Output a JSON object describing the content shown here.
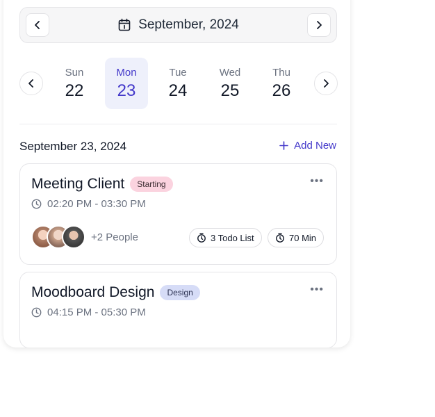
{
  "calendar": {
    "month_title": "September, 2024",
    "days": [
      {
        "name": "Sun",
        "num": "22"
      },
      {
        "name": "Mon",
        "num": "23"
      },
      {
        "name": "Tue",
        "num": "24"
      },
      {
        "name": "Wed",
        "num": "25"
      },
      {
        "name": "Thu",
        "num": "26"
      }
    ],
    "selected_index": 1
  },
  "schedule": {
    "date_heading": "September 23, 2024",
    "add_new_label": "Add New",
    "events": [
      {
        "title": "Meeting Client",
        "badge": "Starting",
        "time": "02:20 PM - 03:30 PM",
        "people_more": "+2 People",
        "todo": "3 Todo List",
        "duration": "70 Min"
      },
      {
        "title": "Moodboard Design",
        "badge": "Design",
        "time": "04:15 PM - 05:30 PM"
      }
    ]
  },
  "colors": {
    "accent": "#4338ca",
    "badge_starting": "#fbd3df",
    "badge_design": "#d6dcf7"
  }
}
